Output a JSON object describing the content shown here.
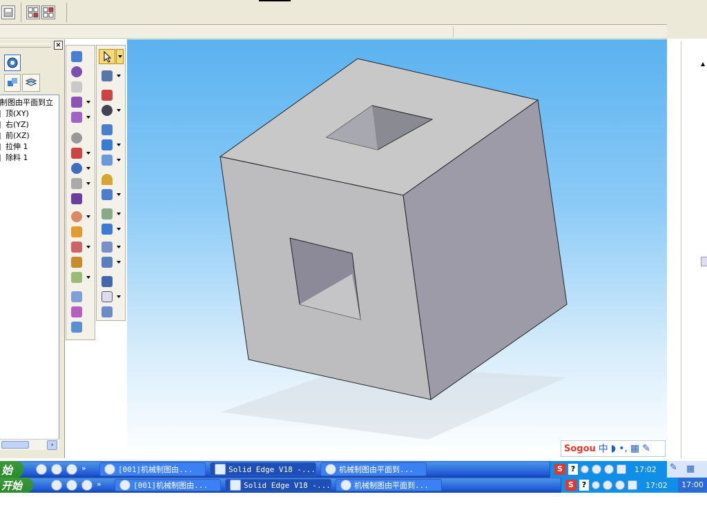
{
  "tree": {
    "items": [
      "制图由平面到立",
      "顶(XY)",
      "右(YZ)",
      "前(XZ)",
      "拉伸 1",
      "除料 1"
    ]
  },
  "ime": {
    "brand": "Sogou",
    "mode": "中"
  },
  "taskbar1": {
    "start_label": "始",
    "tasks": [
      "[001]机械制图由...",
      "Solid Edge V18 -...",
      "机械制图由平面到..."
    ],
    "clock": "17:02"
  },
  "taskbar2": {
    "start_label": "开始",
    "tasks": [
      "[001]机械制图由...",
      "Solid Edge V18 -...",
      "机械制图由平面到..."
    ],
    "clock": "17:02",
    "clock2": "17:00"
  },
  "colors": {
    "viewport_top": "#5ab2f0",
    "taskbar_blue": "#2157d7",
    "start_green": "#3c9a3c",
    "tray_blue": "#0f8fe8"
  }
}
